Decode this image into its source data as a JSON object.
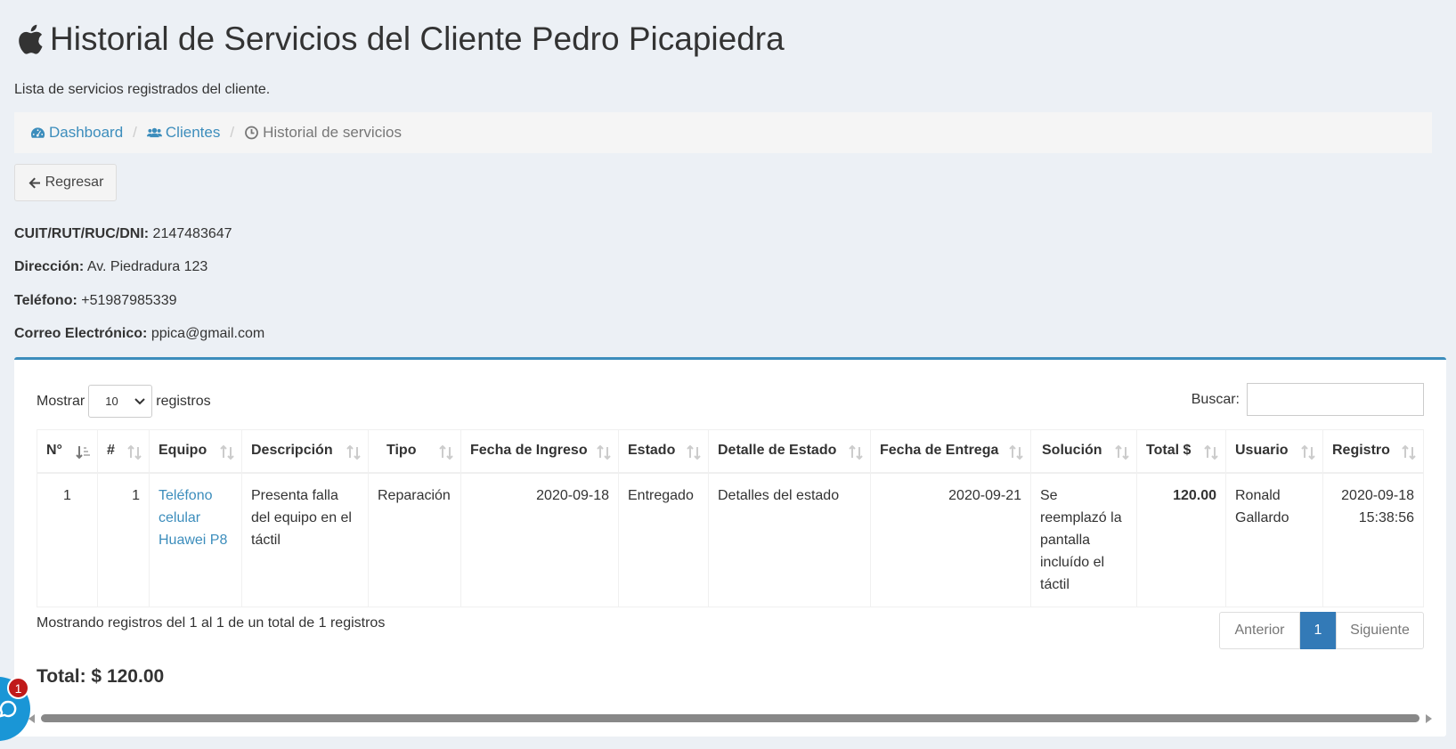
{
  "header": {
    "title": "Historial de Servicios del Cliente Pedro Picapiedra",
    "subtitle": "Lista de servicios registrados del cliente."
  },
  "breadcrumb": [
    {
      "label": "Dashboard",
      "icon": "dashboard-icon"
    },
    {
      "label": "Clientes",
      "icon": "users-icon"
    },
    {
      "label": "Historial de servicios",
      "icon": "clock-icon"
    }
  ],
  "back_button": "Regresar",
  "client": {
    "id_label": "CUIT/RUT/RUC/DNI:",
    "id_value": "2147483647",
    "address_label": "Dirección:",
    "address_value": "Av. Piedradura 123",
    "phone_label": "Teléfono:",
    "phone_value": "+51987985339",
    "email_label": "Correo Electrónico:",
    "email_value": "ppica@gmail.com"
  },
  "table_controls": {
    "show_label": "Mostrar",
    "page_size": "10",
    "records_label": "registros",
    "search_label": "Buscar:",
    "search_value": ""
  },
  "columns": [
    "N°",
    "#",
    "Equipo",
    "Descripción",
    "Tipo",
    "Fecha de Ingreso",
    "Estado",
    "Detalle de Estado",
    "Fecha de Entrega",
    "Solución",
    "Total $",
    "Usuario",
    "Registro"
  ],
  "rows": [
    {
      "n": "1",
      "num": "1",
      "equipo": "Teléfono celular Huawei P8",
      "descripcion": "Presenta falla del equipo en el táctil",
      "tipo": "Reparación",
      "fecha_ingreso": "2020-09-18",
      "estado": "Entregado",
      "detalle_estado": "Detalles del estado",
      "fecha_entrega": "2020-09-21",
      "solucion": "Se reemplazó la pantalla incluído el táctil",
      "total": "120.00",
      "usuario": "Ronald Gallardo",
      "registro": "2020-09-18 15:38:56"
    }
  ],
  "footer": {
    "info": "Mostrando registros del 1 al 1 de un total de 1 registros",
    "prev": "Anterior",
    "page": "1",
    "next": "Siguiente",
    "total": "Total: $ 120.00"
  },
  "chat_badge": "1",
  "colors": {
    "accent": "#3c8dbc",
    "background": "#ecf0f5",
    "active_page": "#337ab7",
    "badge": "#c01a1a",
    "chat": "#1a96d6"
  }
}
